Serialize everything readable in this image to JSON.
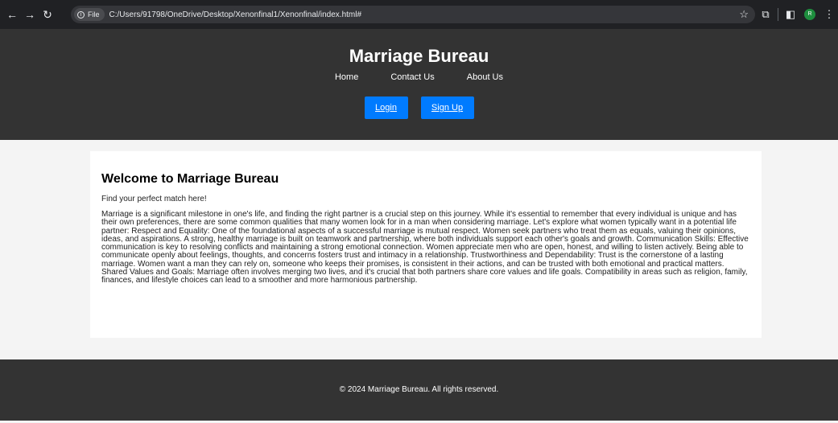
{
  "browser": {
    "file_chip": "File",
    "url": "C:/Users/91798/OneDrive/Desktop/Xenonfinal1/Xenonfinal/index.html#",
    "profile_initial": "R"
  },
  "site": {
    "title": "Marriage Bureau",
    "nav": [
      "Home",
      "Contact Us",
      "About Us"
    ],
    "login_label": "Login",
    "signup_label": "Sign Up"
  },
  "main": {
    "heading": "Welcome to Marriage Bureau",
    "tagline": "Find your perfect match here!",
    "body": "Marriage is a significant milestone in one's life, and finding the right partner is a crucial step on this journey. While it's essential to remember that every individual is unique and has their own preferences, there are some common qualities that many women look for in a man when considering marriage. Let's explore what women typically want in a potential life partner: Respect and Equality: One of the foundational aspects of a successful marriage is mutual respect. Women seek partners who treat them as equals, valuing their opinions, ideas, and aspirations. A strong, healthy marriage is built on teamwork and partnership, where both individuals support each other's goals and growth. Communication Skills: Effective communication is key to resolving conflicts and maintaining a strong emotional connection. Women appreciate men who are open, honest, and willing to listen actively. Being able to communicate openly about feelings, thoughts, and concerns fosters trust and intimacy in a relationship. Trustworthiness and Dependability: Trust is the cornerstone of a lasting marriage. Women want a man they can rely on, someone who keeps their promises, is consistent in their actions, and can be trusted with both emotional and practical matters. Shared Values and Goals: Marriage often involves merging two lives, and it's crucial that both partners share core values and life goals. Compatibility in areas such as religion, family, finances, and lifestyle choices can lead to a smoother and more harmonious partnership."
  },
  "footer": {
    "text": "© 2024 Marriage Bureau. All rights reserved."
  },
  "colors": {
    "header_bg": "#333333",
    "button_bg": "#007bff",
    "page_bg": "#f4f4f4"
  }
}
